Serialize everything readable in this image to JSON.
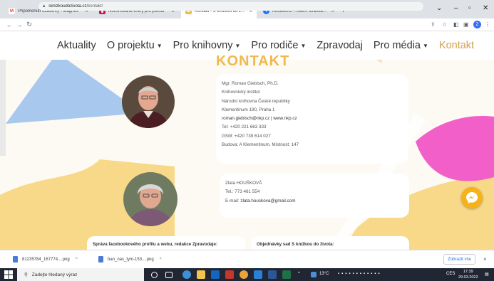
{
  "browser": {
    "tabs": [
      {
        "title": "Připomenutí uzávěrky - Magnes",
        "icon": "gmail-icon",
        "color": "#ea4335",
        "glyph": "M",
        "active": false
      },
      {
        "title": "Nominované knihy pro porotu",
        "icon": "bookmark-icon",
        "color": "#c2185b",
        "glyph": "▮",
        "active": false
      },
      {
        "title": "Kontakt - S knížkou do života",
        "icon": "site-icon",
        "color": "#f1b94c",
        "glyph": "✿",
        "active": true
      },
      {
        "title": "KuluktiCO - Hlavní stránka | Face",
        "icon": "facebook-icon",
        "color": "#1877f2",
        "glyph": "f",
        "active": false
      }
    ],
    "new_tab": "+",
    "address": {
      "domain": "sknizkoudozivota.cz",
      "path": "/kontakt/"
    },
    "profile_initial": "Z"
  },
  "site": {
    "menu": [
      {
        "label": "Aktuality",
        "dropdown": false,
        "active": false
      },
      {
        "label": "O projektu",
        "dropdown": true,
        "active": false
      },
      {
        "label": "Pro knihovny",
        "dropdown": true,
        "active": false
      },
      {
        "label": "Pro rodiče",
        "dropdown": true,
        "active": false
      },
      {
        "label": "Zpravodaj",
        "dropdown": false,
        "active": false
      },
      {
        "label": "Pro média",
        "dropdown": true,
        "active": false
      },
      {
        "label": "Kontakt",
        "dropdown": false,
        "active": true
      }
    ],
    "headline": "KONTAKT",
    "contact1": {
      "lines": [
        "Mgr. Roman Giebisch, Ph.D.",
        "Knihovnický institut",
        "Národní knihovna České republiky",
        "Klementinum 190, Praha 1",
        "roman.giebisch@nkp.cz | www.nkp.cz",
        "Tel: +420 221 663 333",
        "GSM: +420 739 614 027",
        "Budova: A Klementinum, Místnost: 147"
      ]
    },
    "contact2": {
      "name": "Zlata HOUŠKOVÁ",
      "phone": "Tel.: 773 461 554",
      "email_label": "E-mail:",
      "email": "zlata.houskova@gmail.com"
    },
    "box_left": "Správa facebookového profilu a webu, redakce Zpravodaje:",
    "box_right": "Objednávky sad S knížkou do života:"
  },
  "downloads": {
    "items": [
      "81235784_167774....png",
      "ban_nas_tym-153....png"
    ],
    "show_all": "Zobrazit vše"
  },
  "taskbar": {
    "search_placeholder": "Zadejte hledaný výraz",
    "weather": "13°C",
    "lang": "CES",
    "time": "17:39",
    "date": "29.03.2022"
  },
  "colors": {
    "accent": "#f1b94c",
    "pink": "#f35fc8",
    "blue": "#a9c8ee",
    "yellow": "#f8d98a"
  }
}
